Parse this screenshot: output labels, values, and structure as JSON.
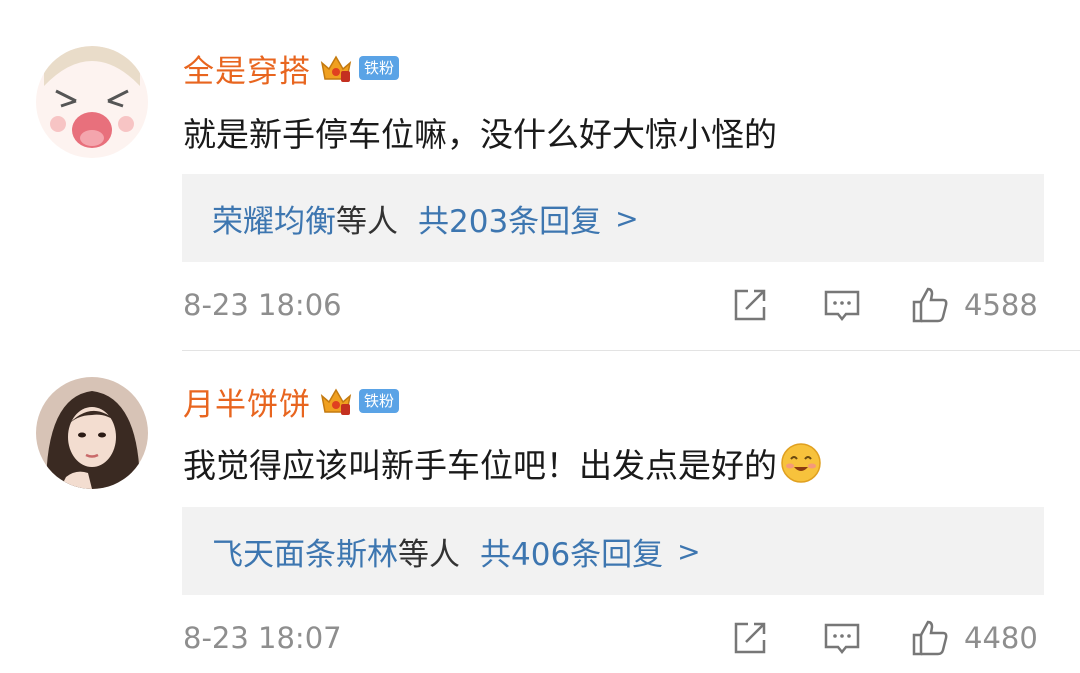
{
  "comments": [
    {
      "username": "全是穿搭",
      "badge": "铁粉",
      "text": "就是新手停车位嘛，没什么好大惊小怪的",
      "has_emoji": false,
      "replies": {
        "users": "荣耀均衡",
        "others": "等人",
        "count": "共203条回复",
        "chevron": ">"
      },
      "time": "8-23 18:06",
      "likes": "4588"
    },
    {
      "username": "月半饼饼",
      "badge": "铁粉",
      "text": "我觉得应该叫新手车位吧！出发点是好的",
      "has_emoji": true,
      "replies": {
        "users": "飞天面条斯林",
        "others": "等人",
        "count": "共406条回复",
        "chevron": ">"
      },
      "time": "8-23 18:07",
      "likes": "4480"
    }
  ],
  "colors": {
    "username": "#e8651f",
    "link": "#3d76b0",
    "meta": "#8e8e8e",
    "badge": "#5aa3e6",
    "reply_bg": "#f2f2f2"
  },
  "icons": [
    "crown-vip-icon",
    "share-icon",
    "comment-icon",
    "like-icon",
    "smile-emoji-icon"
  ]
}
